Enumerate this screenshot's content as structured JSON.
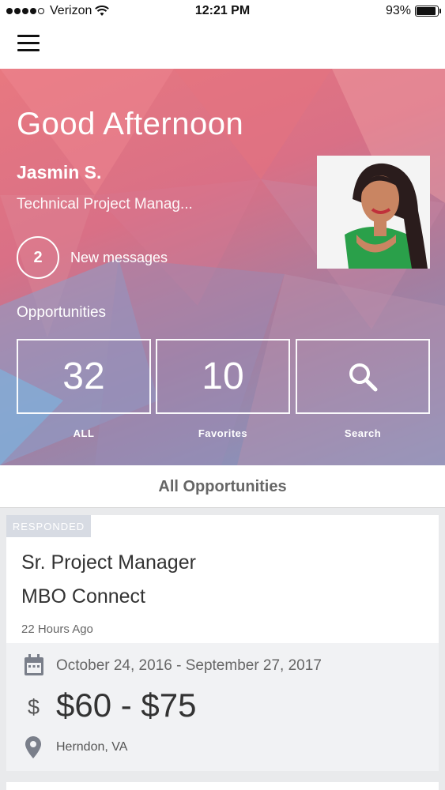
{
  "status_bar": {
    "carrier": "Verizon",
    "time": "12:21 PM",
    "battery_percent": "93%",
    "battery_level": 0.93,
    "signal_bars": 4
  },
  "nav": {
    "menu_icon": "hamburger-menu-icon"
  },
  "hero": {
    "greeting": "Good Afternoon",
    "user_name": "Jasmin S.",
    "user_title": "Technical Project Manag...",
    "messages_count": "2",
    "messages_label": "New messages",
    "opportunities_label": "Opportunities",
    "tiles": [
      {
        "value": "32",
        "caption": "ALL"
      },
      {
        "value": "10",
        "caption": "Favorites"
      },
      {
        "icon": "search-icon",
        "caption": "Search"
      }
    ]
  },
  "section": {
    "title": "All Opportunities"
  },
  "card": {
    "badge": "RESPONDED",
    "title": "Sr. Project Manager",
    "company": "MBO Connect",
    "posted": "22 Hours Ago",
    "date_range": "October 24, 2016 - September 27, 2017",
    "currency_symbol": "$",
    "rate": "$60 - $75",
    "location": "Herndon, VA"
  },
  "colors": {
    "hero_start": "#e87880",
    "hero_end": "#7e9bc6",
    "badge_bg": "#d7dbe3"
  }
}
